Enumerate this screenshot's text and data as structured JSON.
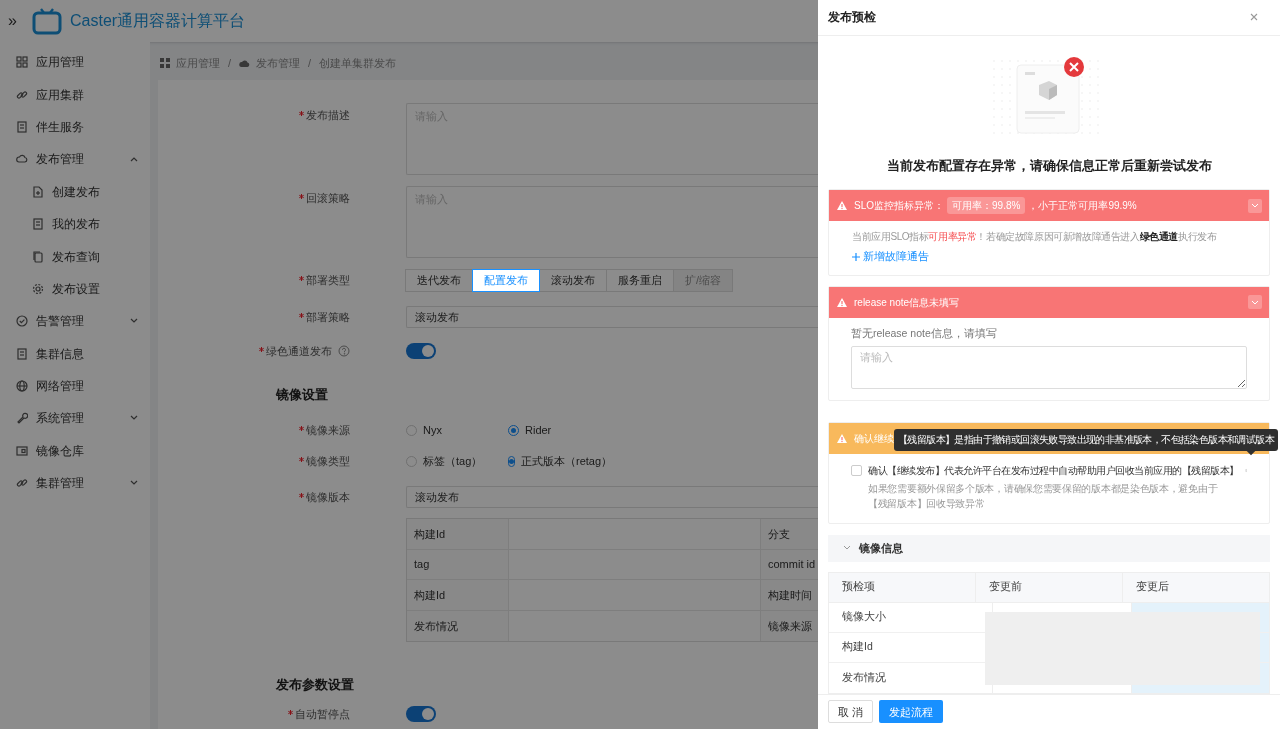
{
  "app": {
    "title": "Caster通用容器计算平台",
    "toggle": "»"
  },
  "sidebar": {
    "items": [
      {
        "label": "应用管理",
        "kind": "link"
      },
      {
        "label": "应用集群",
        "kind": "link"
      },
      {
        "label": "伴生服务",
        "kind": "link"
      },
      {
        "label": "发布管理",
        "kind": "group",
        "expanded": true,
        "children": [
          {
            "label": "创建发布"
          },
          {
            "label": "我的发布"
          },
          {
            "label": "发布查询"
          },
          {
            "label": "发布设置"
          }
        ]
      },
      {
        "label": "告警管理",
        "kind": "group",
        "expanded": false
      },
      {
        "label": "集群信息",
        "kind": "link"
      },
      {
        "label": "网络管理",
        "kind": "link"
      },
      {
        "label": "系统管理",
        "kind": "group",
        "expanded": false
      },
      {
        "label": "镜像仓库",
        "kind": "link"
      },
      {
        "label": "集群管理",
        "kind": "group",
        "expanded": false
      }
    ]
  },
  "breadcrumb": [
    "应用管理",
    "发布管理",
    "创建单集群发布"
  ],
  "breadcrumb_separator": "/",
  "form": [
    {
      "kind": "textarea",
      "label": "发布描述",
      "required": true,
      "placeholder": "请输入"
    },
    {
      "kind": "textarea",
      "label": "回滚策略",
      "required": true,
      "placeholder": "请输入"
    },
    {
      "kind": "segmented",
      "label": "部署类型",
      "required": true,
      "options": [
        {
          "label": "迭代发布",
          "selected": false,
          "disabled": false
        },
        {
          "label": "配置发布",
          "selected": true,
          "disabled": false
        },
        {
          "label": "滚动发布",
          "selected": false,
          "disabled": false
        },
        {
          "label": "服务重启",
          "selected": false,
          "disabled": false
        },
        {
          "label": "扩/缩容",
          "selected": false,
          "disabled": true
        }
      ]
    },
    {
      "kind": "select",
      "label": "部署策略",
      "required": true,
      "value": "滚动发布"
    },
    {
      "kind": "switch",
      "label": "绿色通道发布",
      "required": true,
      "help": true,
      "on": true
    },
    {
      "kind": "section",
      "label": "镜像设置"
    },
    {
      "kind": "radio",
      "label": "镜像来源",
      "required": true,
      "options": [
        {
          "label": "Nyx",
          "selected": false
        },
        {
          "label": "Rider",
          "selected": true
        }
      ]
    },
    {
      "kind": "radio",
      "label": "镜像类型",
      "required": true,
      "options": [
        {
          "label": "标签（tag）",
          "selected": false
        },
        {
          "label": "正式版本（retag）",
          "selected": true
        }
      ]
    },
    {
      "kind": "select",
      "label": "镜像版本",
      "required": true,
      "value": "滚动发布"
    },
    {
      "kind": "table",
      "rows": [
        {
          "label": "构建Id",
          "label_2": "分支"
        },
        {
          "label": "tag",
          "label_2": "commit id"
        },
        {
          "label": "构建Id",
          "label_2": "构建时间"
        },
        {
          "label": "发布情况",
          "label_2": "镜像来源"
        }
      ]
    },
    {
      "kind": "section",
      "label": "发布参数设置"
    },
    {
      "kind": "switch",
      "label": "自动暂停点",
      "required": true,
      "help": false,
      "on": true
    }
  ],
  "drawer": {
    "title": "发布预检",
    "message": "当前发布配置存在异常，请确保信息正常后重新尝试发布",
    "alerts": [
      {
        "kind": "error",
        "header": [
          {
            "kind": "text",
            "text": "SLO监控指标异常："
          },
          {
            "kind": "badge",
            "text": "可用率：99.8%"
          },
          {
            "kind": "text",
            "text": "，小于正常可用率99.9%"
          }
        ],
        "body": [
          {
            "kind": "text",
            "text": "当前应用SLO指标"
          },
          {
            "kind": "danger",
            "text": "可用率异常"
          },
          {
            "kind": "text",
            "text": "！若确定故障原因可新增故障通告进入"
          },
          {
            "kind": "strong",
            "text": "绿色通道"
          },
          {
            "kind": "text",
            "text": "执行发布"
          }
        ],
        "link": "新增故障通告"
      },
      {
        "kind": "error",
        "header": [
          {
            "kind": "text",
            "text": "release note信息未填写"
          }
        ],
        "note": "暂无release note信息，请填写",
        "placeholder": "请输入"
      },
      {
        "kind": "warning",
        "header": [
          {
            "kind": "text",
            "text": "确认继续"
          }
        ],
        "checkbox": {
          "label": "确认【继续发布】代表允许平台在发布过程中自动帮助用户回收当前应用的【残留版本】",
          "checked": false
        },
        "hint": "如果您需要额外保留多个版本，请确保您需要保留的版本都是染色版本，避免由于【残留版本】回收导致异常",
        "tooltip": "【残留版本】是指由于撤销或回滚失败导致出现的非基准版本，不包括染色版本和调试版本"
      }
    ],
    "image_info": {
      "title": "镜像信息",
      "expanded": true,
      "columns": [
        "预检项",
        "变更前",
        "变更后"
      ],
      "rows": [
        "镜像大小",
        "构建Id",
        "发布情况"
      ],
      "loading": true
    },
    "buttons": [
      {
        "label": "取 消",
        "kind": "default"
      },
      {
        "label": "发起流程",
        "kind": "primary"
      }
    ]
  }
}
